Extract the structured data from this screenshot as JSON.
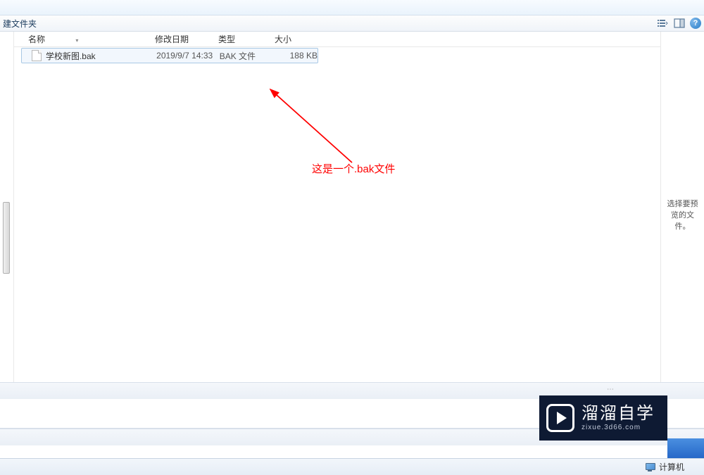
{
  "toolbar": {
    "label": "建文件夹"
  },
  "columns": {
    "name": "名称",
    "date": "修改日期",
    "type": "类型",
    "size": "大小"
  },
  "files": [
    {
      "name": "学校新图.bak",
      "date": "2019/9/7 14:33",
      "type": "BAK 文件",
      "size": "188 KB"
    }
  ],
  "preview": {
    "message": "选择要预览的文件。"
  },
  "annotation": {
    "text": "这是一个.bak文件"
  },
  "statusbar": {
    "computer": "计算机"
  },
  "watermark": {
    "title": "溜溜自学",
    "url": "zixue.3d66.com"
  }
}
